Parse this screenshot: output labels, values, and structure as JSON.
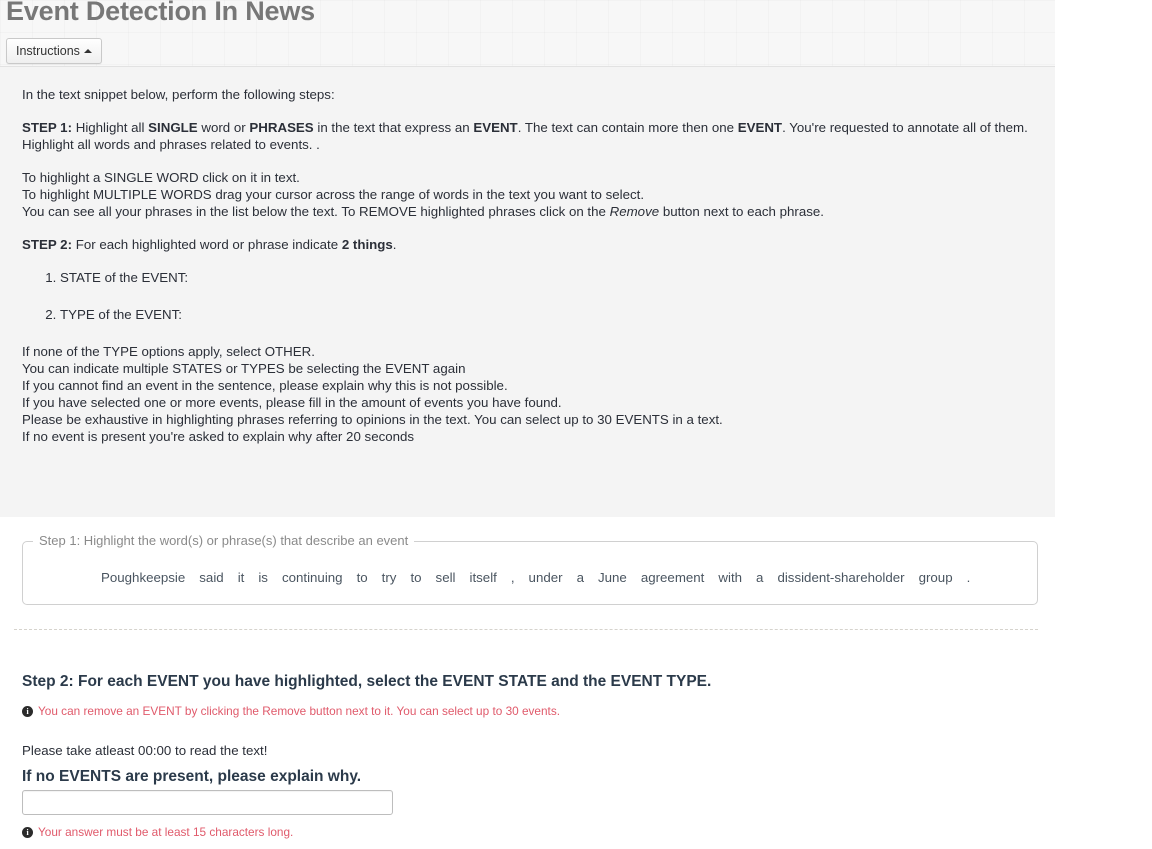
{
  "header": {
    "title": "Event Detection In News",
    "instructions_button": "Instructions",
    "caret_icon": "caret-up-icon"
  },
  "instructions": {
    "intro": "In the text snippet below, perform the following steps:",
    "step1": {
      "label": "STEP 1:",
      "part1": " Highlight all ",
      "single": "SINGLE",
      "part2": " word or ",
      "phrases": "PHRASES",
      "part3": " in the text that express an ",
      "event1": "EVENT",
      "part4": ". The text can contain more then one ",
      "event2": "EVENT",
      "part5": ". You're requested to annotate all of them.",
      "line2": "Highlight all words and phrases related to events. ."
    },
    "how_to": {
      "line1": "To highlight a SINGLE WORD click on it in text.",
      "line2": "To highlight MULTIPLE WORDS drag your cursor across the range of words in the text you want to select.",
      "line3_a": "You can see all your phrases in the list below the text. To REMOVE highlighted phrases click on the ",
      "line3_remove": "Remove",
      "line3_b": " button next to each phrase."
    },
    "step2": {
      "label": "STEP 2:",
      "part1": " For each highlighted word or phrase indicate ",
      "things": "2 things",
      "part2": "."
    },
    "numbered_items": [
      "STATE of the EVENT:",
      "TYPE of the EVENT:"
    ],
    "footer_lines": [
      "If none of the TYPE options apply, select OTHER.",
      "You can indicate multiple STATES or TYPES be selecting the EVENT again",
      "If you cannot find an event in the sentence, please explain why this is not possible.",
      "If you have selected one or more events, please fill in the amount of events you have found.",
      "Please be exhaustive in highlighting phrases referring to opinions in the text. You can select up to 30 EVENTS in a text.",
      "If no event is present you're asked to explain why after 20 seconds"
    ]
  },
  "step1_section": {
    "legend": "Step 1: Highlight the word(s) or phrase(s) that describe an event",
    "tokens": [
      "Poughkeepsie",
      "said",
      "it",
      "is",
      "continuing",
      "to",
      "try",
      "to",
      "sell",
      "itself",
      ",",
      "under",
      "a",
      "June",
      "agreement",
      "with",
      "a",
      "dissident-shareholder",
      "group",
      "."
    ]
  },
  "step2_section": {
    "heading": "Step 2: For each EVENT you have highlighted, select the EVENT STATE and the EVENT TYPE.",
    "note_icon": "info-icon",
    "note": "You can remove an EVENT by clicking the Remove button next to it. You can select up to 30 events.",
    "read_time": "Please take atleast 00:00 to read the text!",
    "no_events_heading": "If no EVENTS are present, please explain why.",
    "explain_value": "",
    "explain_placeholder": "",
    "validation_icon": "info-icon",
    "validation": "Your answer must be at least 15 characters long."
  },
  "colors": {
    "error_red": "#e05a6b",
    "heading_gray": "#777777",
    "panel_bg": "#f4f4f4",
    "text": "#2b2f38"
  }
}
